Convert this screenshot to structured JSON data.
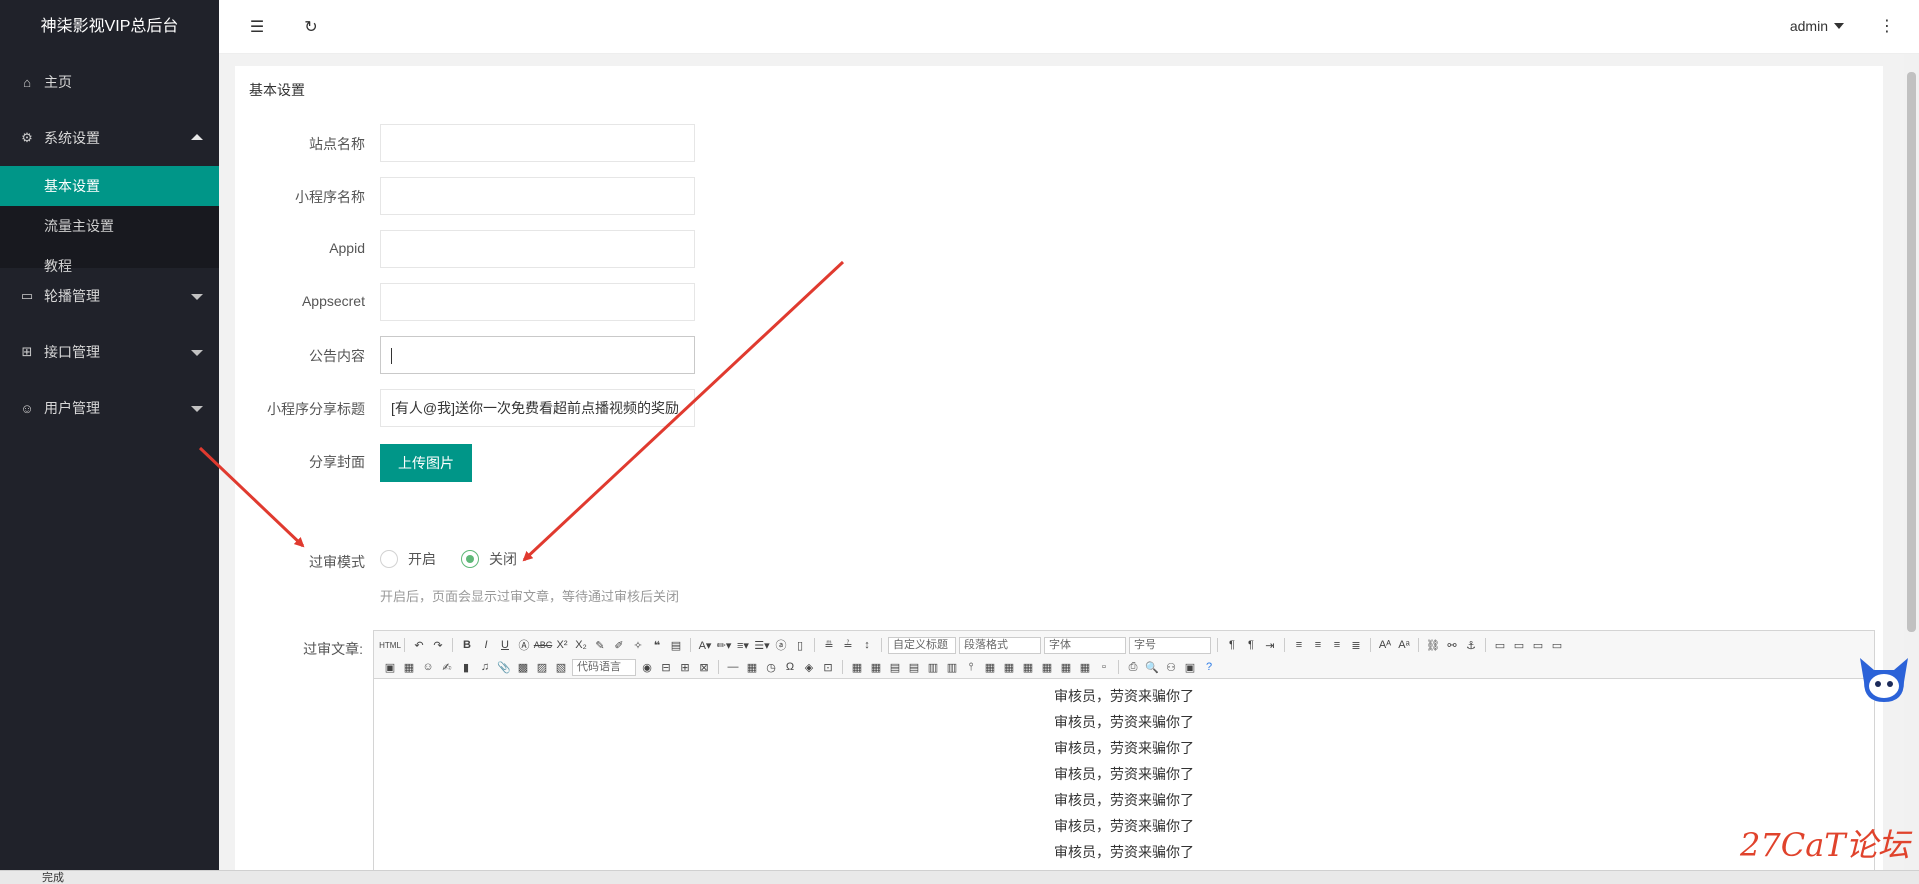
{
  "sidebar": {
    "logo": "神柒影视VIP总后台",
    "items": [
      {
        "label": "主页",
        "icon": "home-icon"
      },
      {
        "label": "系统设置",
        "icon": "gear-icon"
      },
      {
        "label": "轮播管理",
        "icon": "image-icon"
      },
      {
        "label": "接口管理",
        "icon": "apps-icon"
      },
      {
        "label": "用户管理",
        "icon": "user-icon"
      }
    ],
    "subitems": [
      {
        "label": "基本设置"
      },
      {
        "label": "流量主设置"
      },
      {
        "label": "教程"
      }
    ]
  },
  "header": {
    "user": "admin"
  },
  "form": {
    "title": "基本设置",
    "site_name_label": "站点名称",
    "site_name_value": "",
    "mini_name_label": "小程序名称",
    "mini_name_value": "",
    "appid_label": "Appid",
    "appid_value": "",
    "appsecret_label": "Appsecret",
    "appsecret_value": "",
    "notice_label": "公告内容",
    "notice_value": "",
    "share_title_label": "小程序分享标题",
    "share_title_value": "[有人@我]送你一次免费看超前点播视频的奖励",
    "share_cover_label": "分享封面",
    "upload_button": "上传图片",
    "review_mode_label": "过审模式",
    "review_on": "开启",
    "review_off": "关闭",
    "review_selected": "关闭",
    "review_hint": "开启后，页面会显示过审文章，等待通过审核后关闭",
    "review_article_label": "过审文章:"
  },
  "editor": {
    "custom_heading": "自定义标题",
    "paragraph_format": "段落格式",
    "font_family": "字体",
    "font_size": "字号",
    "code_language": "代码语言",
    "content_lines": [
      "审核员，劳资来骗你了",
      "审核员，劳资来骗你了",
      "审核员，劳资来骗你了",
      "审核员，劳资来骗你了",
      "审核员，劳资来骗你了",
      "审核员，劳资来骗你了",
      "审核员，劳资来骗你了"
    ]
  },
  "statusbar": {
    "text": "完成"
  },
  "watermark": "27CaT论坛",
  "colors": {
    "sidebar_bg": "#20222a",
    "accent": "#009688",
    "radio_on": "#5fb878",
    "arrow": "#e03a2f"
  }
}
